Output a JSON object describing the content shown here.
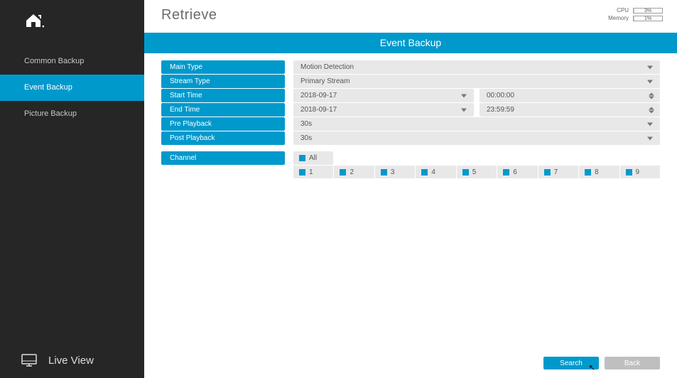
{
  "sidebar": {
    "items": [
      {
        "label": "Common Backup"
      },
      {
        "label": "Event Backup"
      },
      {
        "label": "Picture Backup"
      }
    ],
    "live_label": "Live View"
  },
  "header": {
    "title": "Retrieve",
    "stats": {
      "cpu_label": "CPU",
      "cpu_value": "3%",
      "cpu_pct": 3,
      "mem_label": "Memory",
      "mem_value": "1%",
      "mem_pct": 1
    }
  },
  "banner": "Event Backup",
  "form": {
    "main_type": {
      "label": "Main Type",
      "value": "Motion Detection"
    },
    "stream_type": {
      "label": "Stream Type",
      "value": "Primary Stream"
    },
    "start_time": {
      "label": "Start Time",
      "date": "2018-09-17",
      "time": "00:00:00"
    },
    "end_time": {
      "label": "End Time",
      "date": "2018-09-17",
      "time": "23:59:59"
    },
    "pre_playback": {
      "label": "Pre Playback",
      "value": "30s"
    },
    "post_playback": {
      "label": "Post Playback",
      "value": "30s"
    },
    "channel": {
      "label": "Channel",
      "all_label": "All",
      "items": [
        "1",
        "2",
        "3",
        "4",
        "5",
        "6",
        "7",
        "8",
        "9"
      ]
    }
  },
  "buttons": {
    "search": "Search",
    "back": "Back"
  }
}
